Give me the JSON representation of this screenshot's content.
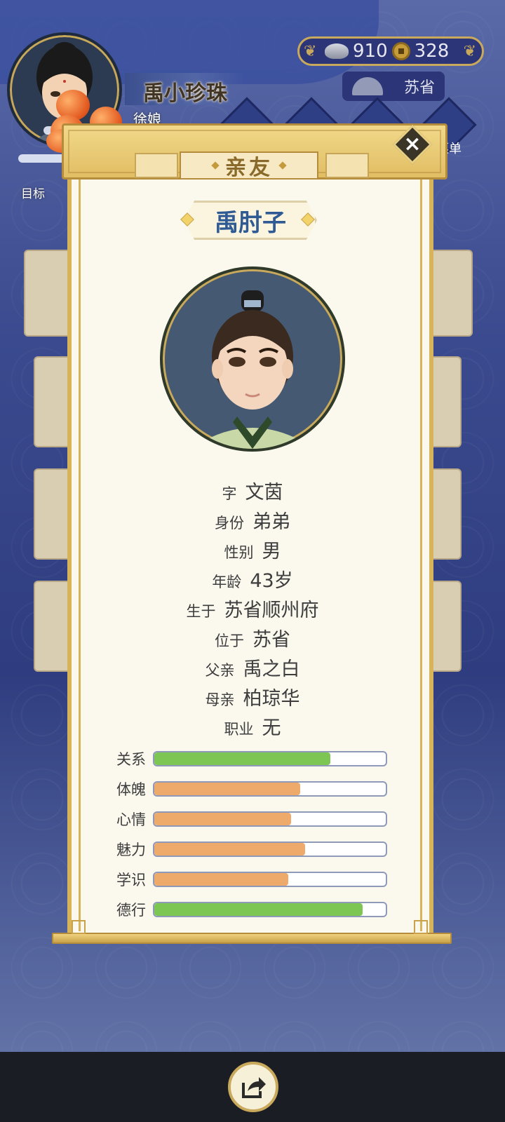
{
  "player": {
    "name": "禹小珍珠",
    "title": "徐娘",
    "goal_label": "目标"
  },
  "currency": {
    "silver": "910",
    "coins": "328"
  },
  "location": "苏省",
  "menu_label": "菜单",
  "dialog": {
    "title": "亲友",
    "close_label": "×",
    "character": {
      "name": "禹肘子",
      "info": [
        {
          "label": "字",
          "value": "文茵"
        },
        {
          "label": "身份",
          "value": "弟弟"
        },
        {
          "label": "性别",
          "value": "男"
        },
        {
          "label": "年龄",
          "value": "43岁"
        },
        {
          "label": "生于",
          "value": "苏省顺州府"
        },
        {
          "label": "位于",
          "value": "苏省"
        },
        {
          "label": "父亲",
          "value": "禹之白"
        },
        {
          "label": "母亲",
          "value": "柏琼华"
        },
        {
          "label": "职业",
          "value": "无"
        }
      ],
      "stats": [
        {
          "label": "关系",
          "fraction": 0.76,
          "color": "green"
        },
        {
          "label": "体魄",
          "fraction": 0.63,
          "color": "orange"
        },
        {
          "label": "心情",
          "fraction": 0.59,
          "color": "orange"
        },
        {
          "label": "魅力",
          "fraction": 0.65,
          "color": "orange"
        },
        {
          "label": "学识",
          "fraction": 0.58,
          "color": "orange"
        },
        {
          "label": "德行",
          "fraction": 0.9,
          "color": "green"
        }
      ]
    }
  },
  "colors": {
    "green_fill": "#7ec653",
    "orange_fill": "#eeaa6a",
    "name_blue": "#2f5a94",
    "gold": "#c9a95b"
  },
  "icons": {
    "currency_silver": "silver-ingot-icon",
    "currency_coin": "copper-coin-icon",
    "location": "iron-icon",
    "close": "close-icon",
    "share": "share-icon"
  }
}
